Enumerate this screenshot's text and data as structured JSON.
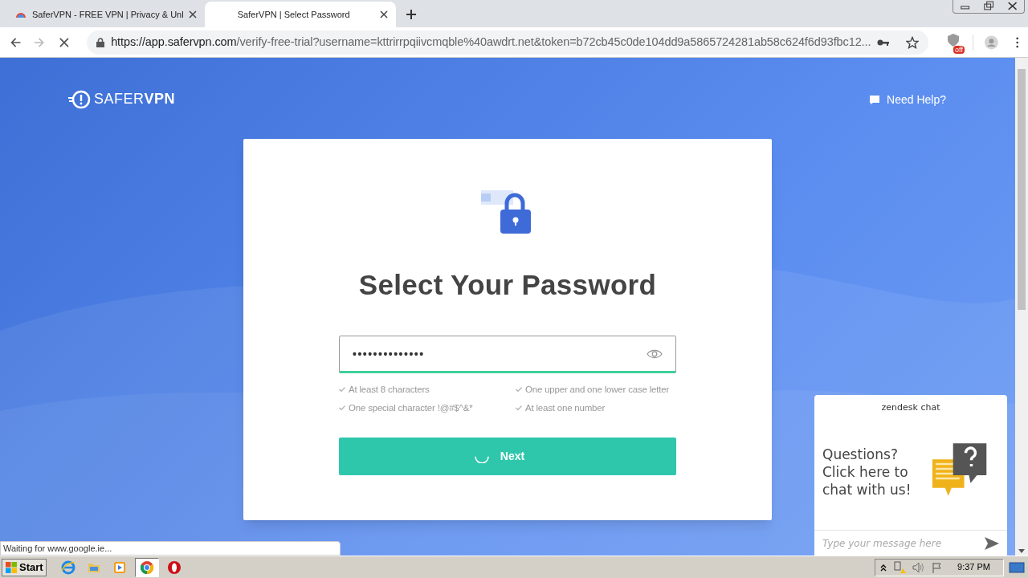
{
  "browser": {
    "tabs": [
      {
        "title": "SaferVPN - FREE VPN | Privacy & Unl",
        "selected": false
      },
      {
        "title": "SaferVPN | Select Password",
        "selected": true
      }
    ],
    "address": {
      "origin": "https://app.safervpn.com",
      "rest": "/verify-free-trial?username=kttrirrpqiivcmqble%40awdrt.net&token=b72cb45c0de104dd9a5865724281ab58c624f6d93fbc12..."
    },
    "extension_badge": "off",
    "loading": true
  },
  "page": {
    "logo": "SAFER**VPN**",
    "help": "Need Help?",
    "card": {
      "title": "Select Your Password",
      "password_mask": "••••••••••••••",
      "rules": [
        {
          "text": "At least 8 characters"
        },
        {
          "text": "One upper and one lower case letter"
        },
        {
          "text": "One special character !@#$^&*"
        },
        {
          "text": "At least one number"
        }
      ],
      "button": {
        "label": "Next",
        "loading": true
      }
    },
    "chat": {
      "header": "zendesk chat",
      "message": "Questions? Click here to chat with us!",
      "placeholder": "Type your message here"
    }
  },
  "status_bar": "Waiting for www.google.ie...",
  "taskbar": {
    "start": "Start",
    "apps": [
      {
        "kind": "ie",
        "selected": false
      },
      {
        "kind": "folder",
        "selected": false
      },
      {
        "kind": "media",
        "selected": false
      },
      {
        "kind": "chrome",
        "selected": true
      },
      {
        "kind": "opera",
        "selected": false
      }
    ],
    "clock": "9:37 PM"
  }
}
